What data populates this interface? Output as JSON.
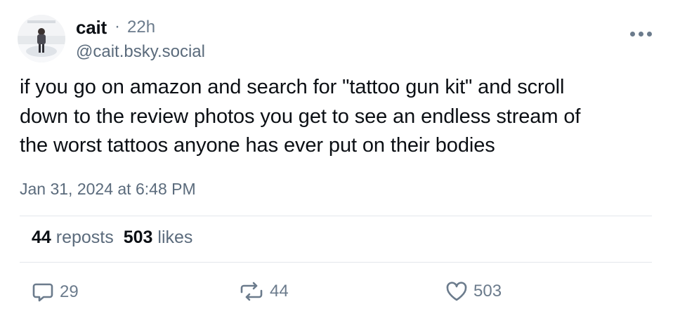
{
  "author": {
    "display_name": "cait",
    "separator": "·",
    "time_ago": "22h",
    "handle": "@cait.bsky.social",
    "avatar_icon": "profile-photo"
  },
  "more_menu_icon": "ellipsis-icon",
  "post": {
    "lines": [
      "if you go on amazon and search for \"tattoo gun kit\" and scroll",
      "down to the review photos you get to see an endless stream of",
      "the worst tattoos anyone has ever put on their bodies"
    ],
    "timestamp": "Jan 31, 2024 at 6:48 PM"
  },
  "stats": {
    "reposts_count": "44",
    "reposts_label": "reposts",
    "likes_count": "503",
    "likes_label": "likes"
  },
  "actions": {
    "reply": {
      "icon": "speech-bubble-icon",
      "count": "29"
    },
    "repost": {
      "icon": "repost-arrows-icon",
      "count": "44"
    },
    "like": {
      "icon": "heart-icon",
      "count": "503"
    }
  },
  "colors": {
    "text_primary": "#0b0f14",
    "text_secondary": "#5b6b7c",
    "icon": "#6b7b8c",
    "divider": "#e3e7eb"
  }
}
